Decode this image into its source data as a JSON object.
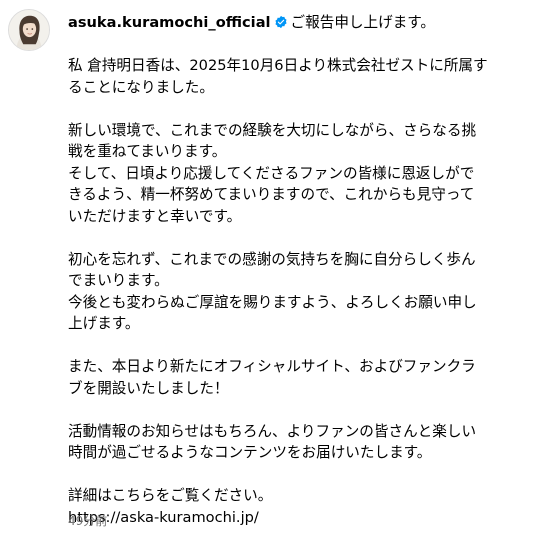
{
  "post": {
    "username": "asuka.kuramochi_official",
    "first_line": "ご報告申し上げます。",
    "p1": [
      "私 倉持明日香は、2025年10月6日より株式会社ゼストに所属す",
      "ることになりました。"
    ],
    "p2": [
      "新しい環境で、これまでの経験を大切にしながら、さらなる挑",
      "戦を重ねてまいります。",
      "そして、日頃より応援してくださるファンの皆様に恩返しがで",
      "きるよう、精一杯努めてまいりますので、これからも見守って",
      "いただけますと幸いです。"
    ],
    "p3": [
      "初心を忘れず、これまでの感謝の気持ちを胸に自分らしく歩ん",
      "でまいります。",
      "今後とも変わらぬご厚誼を賜りますよう、よろしくお願い申し",
      "上げます。"
    ],
    "p4": [
      "また、本日より新たにオフィシャルサイト、およびファンクラ",
      "ブを開設いたしました！"
    ],
    "p5": [
      "活動情報のお知らせはもちろん、よりファンの皆さんと楽しい",
      "時間が過ごせるようなコンテンツをお届けいたします。"
    ],
    "p6": [
      "詳細はこちらをご覧ください。"
    ],
    "link": "https://aska-kuramochi.jp/",
    "time": "49分前"
  },
  "icons": {
    "verified": "verified-badge-icon",
    "avatar": "profile-avatar"
  },
  "colors": {
    "verified": "#0095f6",
    "time": "#737373",
    "text": "#000000"
  }
}
